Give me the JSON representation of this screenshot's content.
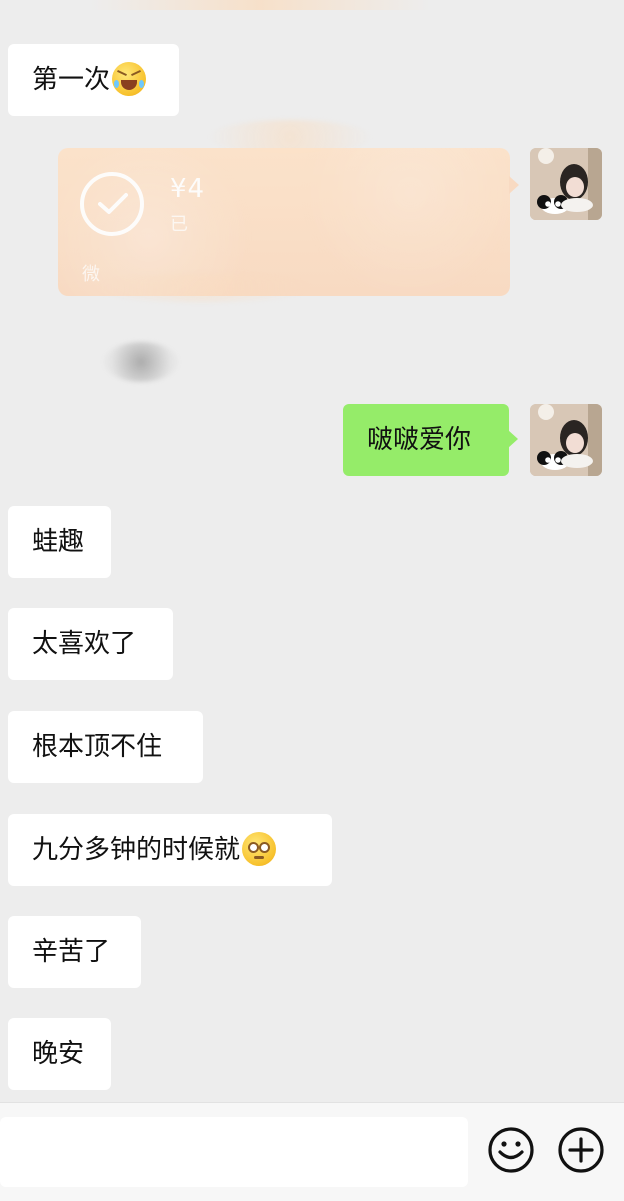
{
  "messages": {
    "m1": {
      "text": "第一次",
      "emoji": "crying-face"
    },
    "m3": {
      "text": "啵啵爱你"
    },
    "m4": {
      "text": "蛙趣"
    },
    "m5": {
      "text": "太喜欢了"
    },
    "m6": {
      "text": "根本顶不住"
    },
    "m7": {
      "text": "九分多钟的时候就",
      "emoji": "pleading-face"
    },
    "m8": {
      "text": "辛苦了"
    },
    "m9": {
      "text": "晚安"
    }
  },
  "transfer": {
    "amount": "¥4",
    "subtitle": "已",
    "footer": "微"
  },
  "colors": {
    "background": "#ededed",
    "incoming_bubble": "#ffffff",
    "outgoing_bubble": "#95ec69",
    "transfer_card": "#fbdcc0",
    "bottom_bar": "#f7f7f7"
  },
  "icons": {
    "emoji_button": "smile-face-icon",
    "more_button": "plus-icon"
  }
}
